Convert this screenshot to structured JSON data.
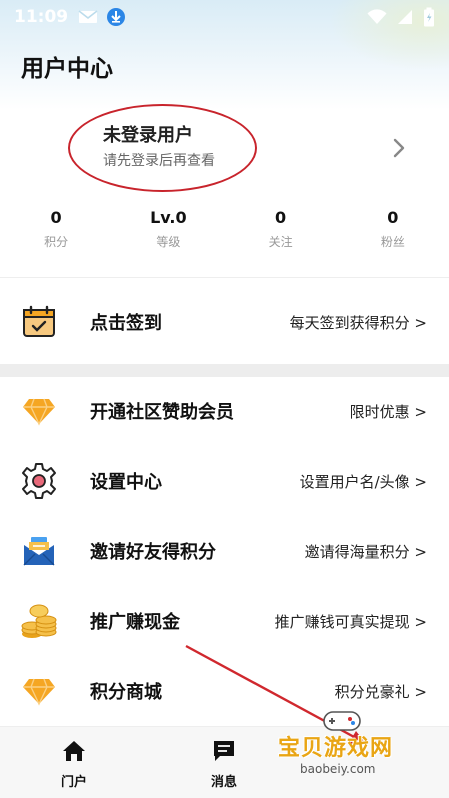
{
  "status_bar": {
    "time": "11:09"
  },
  "page": {
    "title": "用户中心"
  },
  "profile": {
    "name": "未登录用户",
    "hint": "请先登录后再查看"
  },
  "stats": [
    {
      "value": "0",
      "label": "积分"
    },
    {
      "value": "Lv.0",
      "label": "等级"
    },
    {
      "value": "0",
      "label": "关注"
    },
    {
      "value": "0",
      "label": "粉丝"
    }
  ],
  "menu": [
    {
      "title": "点击签到",
      "right": "每天签到获得积分 >",
      "icon": "calendar-check-icon"
    },
    {
      "title": "开通社区赞助会员",
      "right": "限时优惠 >",
      "icon": "diamond-icon"
    },
    {
      "title": "设置中心",
      "right": "设置用户名/头像 >",
      "icon": "gear-icon"
    },
    {
      "title": "邀请好友得积分",
      "right": "邀请得海量积分 >",
      "icon": "envelope-icon"
    },
    {
      "title": "推广赚现金",
      "right": "推广赚钱可真实提现 >",
      "icon": "coins-icon"
    },
    {
      "title": "积分商城",
      "right": "积分兑豪礼 >",
      "icon": "diamond-icon"
    }
  ],
  "bottom_nav": [
    {
      "label": "门户",
      "icon": "home-icon"
    },
    {
      "label": "消息",
      "icon": "message-icon"
    }
  ],
  "watermark": {
    "text": "宝贝游戏网",
    "url": "baobeiy.com"
  },
  "colors": {
    "annotation_red": "#c8242c",
    "icon_orange": "#f5a623",
    "watermark_gold": "#e9a514"
  }
}
